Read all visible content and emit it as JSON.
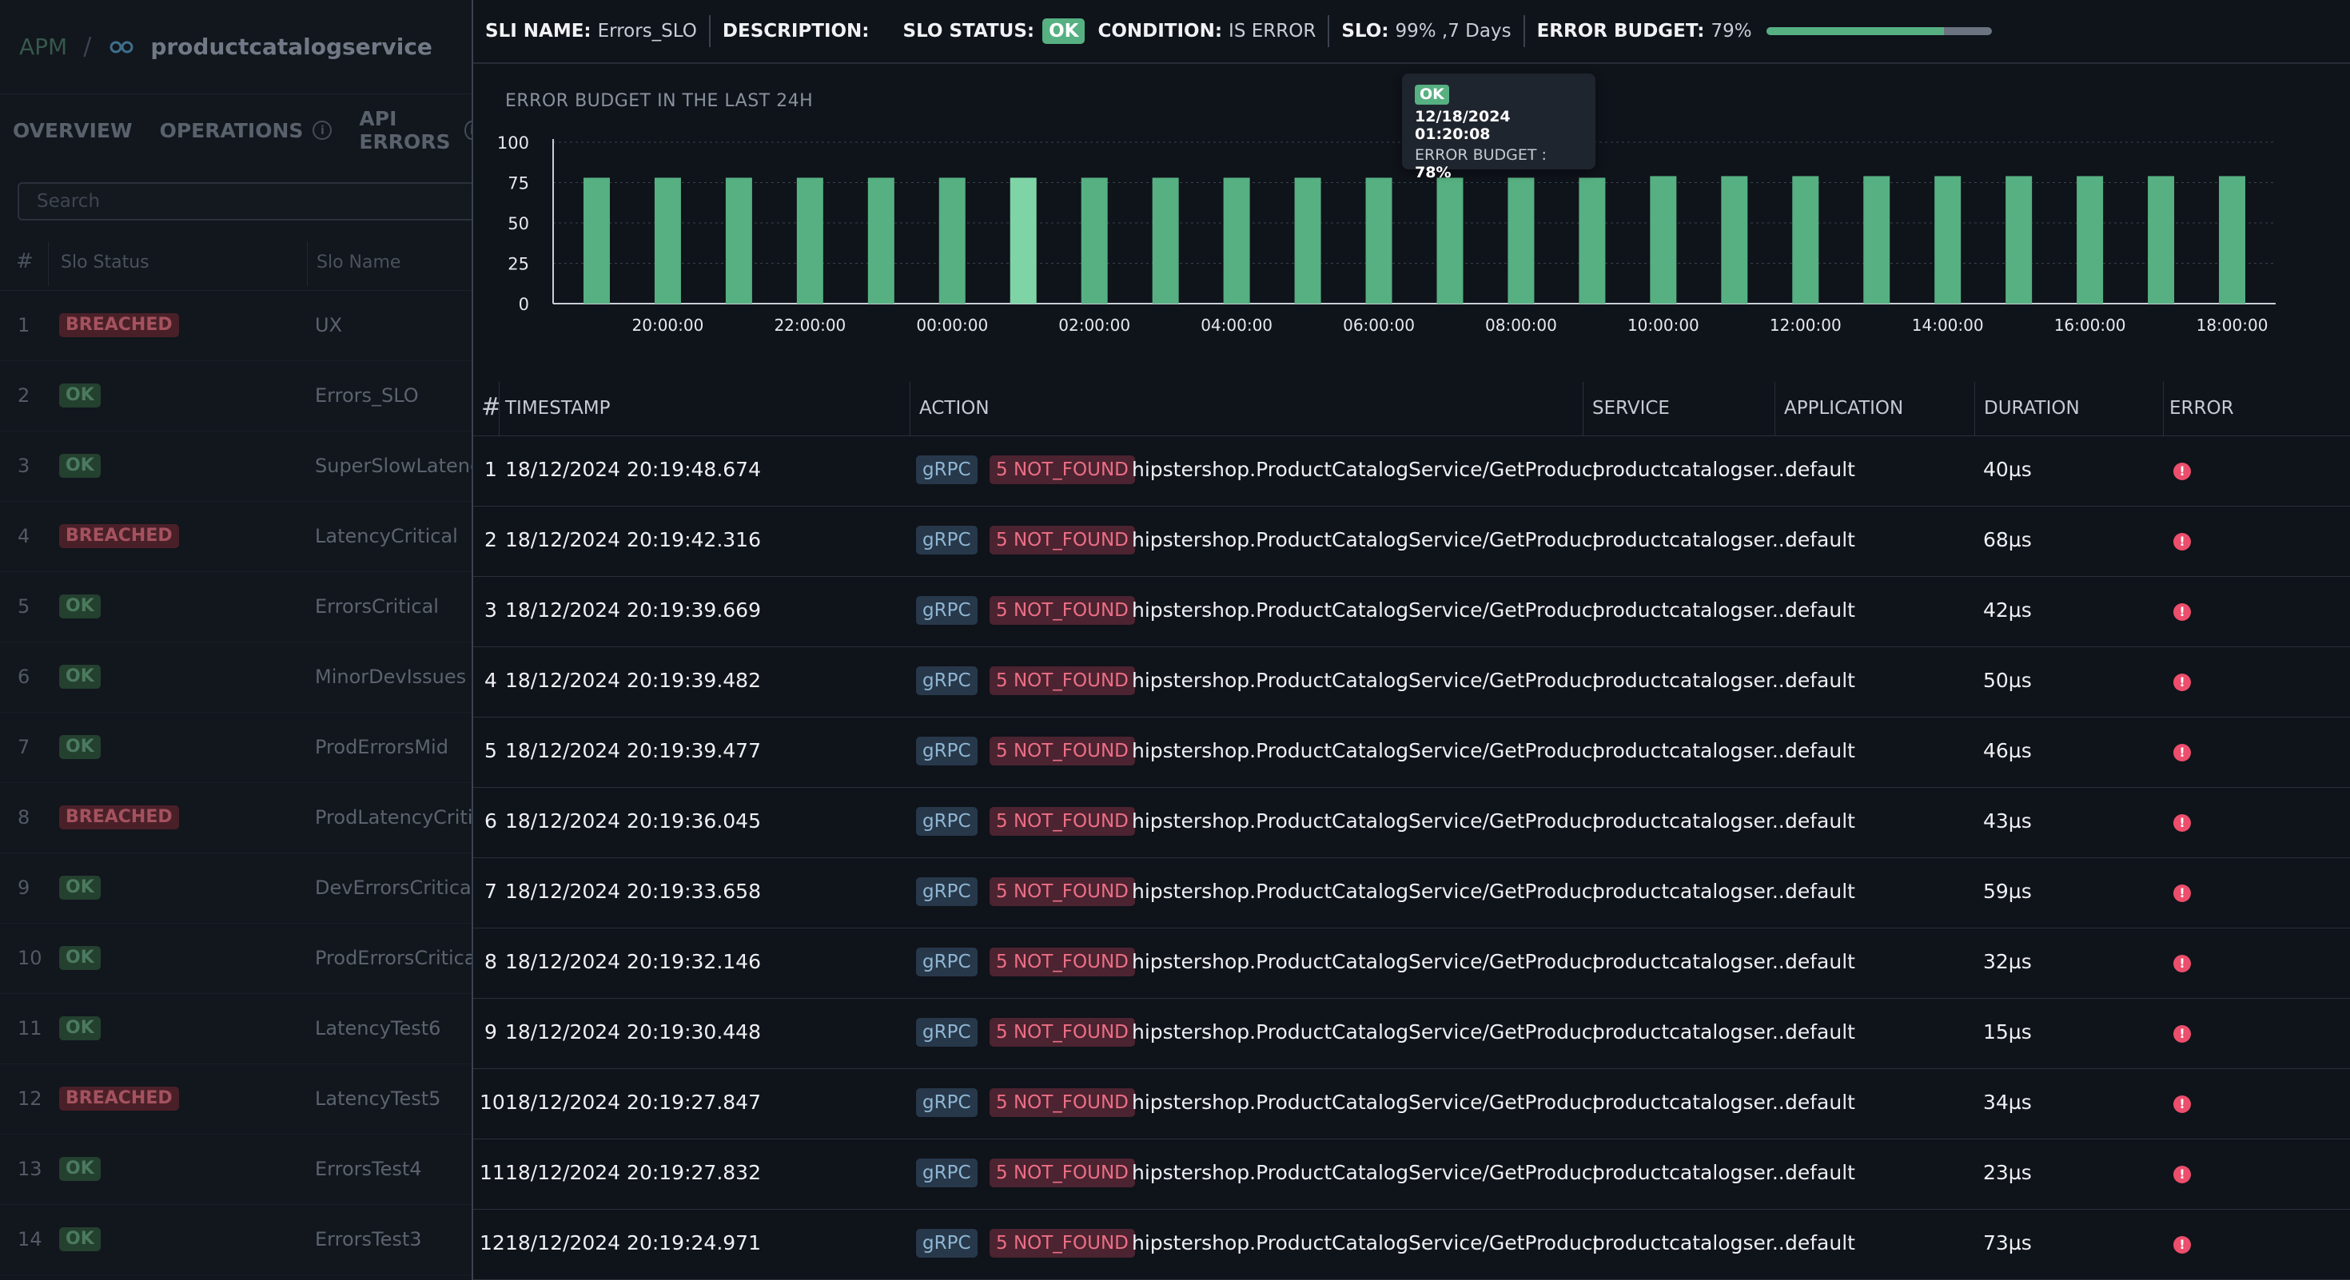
{
  "left_panel": {
    "breadcrumb": {
      "apm": "APM",
      "separator": "/",
      "service": "productcatalogservice"
    },
    "tabs": [
      {
        "label": "OVERVIEW"
      },
      {
        "label": "OPERATIONS"
      },
      {
        "label": "API ERRORS"
      }
    ],
    "search_placeholder": "Search",
    "columns": [
      "#",
      "Slo Status",
      "Slo Name"
    ],
    "rows": [
      {
        "num": "1",
        "status": "BREACHED",
        "name": "UX"
      },
      {
        "num": "2",
        "status": "OK",
        "name": "Errors_SLO"
      },
      {
        "num": "3",
        "status": "OK",
        "name": "SuperSlowLatency"
      },
      {
        "num": "4",
        "status": "BREACHED",
        "name": "LatencyCritical"
      },
      {
        "num": "5",
        "status": "OK",
        "name": "ErrorsCritical"
      },
      {
        "num": "6",
        "status": "OK",
        "name": "MinorDevIssues"
      },
      {
        "num": "7",
        "status": "OK",
        "name": "ProdErrorsMid"
      },
      {
        "num": "8",
        "status": "BREACHED",
        "name": "ProdLatencyCritical"
      },
      {
        "num": "9",
        "status": "OK",
        "name": "DevErrorsCritical"
      },
      {
        "num": "10",
        "status": "OK",
        "name": "ProdErrorsCritical"
      },
      {
        "num": "11",
        "status": "OK",
        "name": "LatencyTest6"
      },
      {
        "num": "12",
        "status": "BREACHED",
        "name": "LatencyTest5"
      },
      {
        "num": "13",
        "status": "OK",
        "name": "ErrorsTest4"
      },
      {
        "num": "14",
        "status": "OK",
        "name": "ErrorsTest3"
      }
    ]
  },
  "sli_bar": {
    "sli_name_label": "SLI NAME:",
    "sli_name": "Errors_SLO",
    "description_label": "DESCRIPTION:",
    "slo_status_label": "SLO STATUS:",
    "slo_status": "OK",
    "condition_label": "CONDITION:",
    "condition": "IS ERROR",
    "slo_label": "SLO:",
    "slo": "99% ,7 Days",
    "error_budget_label": "ERROR BUDGET:",
    "error_budget": "79%",
    "error_budget_fraction": 0.79
  },
  "chart_data": {
    "type": "bar",
    "title": "ERROR BUDGET IN THE LAST 24H",
    "xlabel": "",
    "ylabel": "",
    "ylim": [
      0,
      100
    ],
    "yticks": [
      "0",
      "25",
      "50",
      "75",
      "100"
    ],
    "xticks": [
      "20:00:00",
      "22:00:00",
      "00:00:00",
      "02:00:00",
      "04:00:00",
      "06:00:00",
      "08:00:00",
      "10:00:00",
      "12:00:00",
      "14:00:00",
      "16:00:00",
      "18:00:00"
    ],
    "grid": true,
    "values": [
      78,
      78,
      78,
      78,
      78,
      78,
      78,
      78,
      78,
      78,
      78,
      78,
      78,
      78,
      78,
      79,
      79,
      79,
      79,
      79,
      79,
      79,
      79,
      79
    ],
    "highlight_index": 6,
    "bar_color": "#56b082",
    "highlight_color": "#7fd4a6"
  },
  "tooltip": {
    "status": "OK",
    "timestamp": "12/18/2024 01:20:08",
    "label": "ERROR BUDGET :",
    "value": "78%"
  },
  "table": {
    "columns": [
      "#",
      "TIMESTAMP",
      "ACTION",
      "SERVICE",
      "APPLICATION",
      "DURATION",
      "ERROR"
    ],
    "rows": [
      {
        "num": "1",
        "timestamp": "18/12/2024 20:19:48.674",
        "protocol": "gRPC",
        "status": "5 NOT_FOUND",
        "action": "hipstershop.ProductCatalogService/GetProduct",
        "service": "productcatalogser...",
        "application": "default",
        "duration": "40µs"
      },
      {
        "num": "2",
        "timestamp": "18/12/2024 20:19:42.316",
        "protocol": "gRPC",
        "status": "5 NOT_FOUND",
        "action": "hipstershop.ProductCatalogService/GetProduct",
        "service": "productcatalogser...",
        "application": "default",
        "duration": "68µs"
      },
      {
        "num": "3",
        "timestamp": "18/12/2024 20:19:39.669",
        "protocol": "gRPC",
        "status": "5 NOT_FOUND",
        "action": "hipstershop.ProductCatalogService/GetProduct",
        "service": "productcatalogser...",
        "application": "default",
        "duration": "42µs"
      },
      {
        "num": "4",
        "timestamp": "18/12/2024 20:19:39.482",
        "protocol": "gRPC",
        "status": "5 NOT_FOUND",
        "action": "hipstershop.ProductCatalogService/GetProduct",
        "service": "productcatalogser...",
        "application": "default",
        "duration": "50µs"
      },
      {
        "num": "5",
        "timestamp": "18/12/2024 20:19:39.477",
        "protocol": "gRPC",
        "status": "5 NOT_FOUND",
        "action": "hipstershop.ProductCatalogService/GetProduct",
        "service": "productcatalogser...",
        "application": "default",
        "duration": "46µs"
      },
      {
        "num": "6",
        "timestamp": "18/12/2024 20:19:36.045",
        "protocol": "gRPC",
        "status": "5 NOT_FOUND",
        "action": "hipstershop.ProductCatalogService/GetProduct",
        "service": "productcatalogser...",
        "application": "default",
        "duration": "43µs"
      },
      {
        "num": "7",
        "timestamp": "18/12/2024 20:19:33.658",
        "protocol": "gRPC",
        "status": "5 NOT_FOUND",
        "action": "hipstershop.ProductCatalogService/GetProduct",
        "service": "productcatalogser...",
        "application": "default",
        "duration": "59µs"
      },
      {
        "num": "8",
        "timestamp": "18/12/2024 20:19:32.146",
        "protocol": "gRPC",
        "status": "5 NOT_FOUND",
        "action": "hipstershop.ProductCatalogService/GetProduct",
        "service": "productcatalogser...",
        "application": "default",
        "duration": "32µs"
      },
      {
        "num": "9",
        "timestamp": "18/12/2024 20:19:30.448",
        "protocol": "gRPC",
        "status": "5 NOT_FOUND",
        "action": "hipstershop.ProductCatalogService/GetProduct",
        "service": "productcatalogser...",
        "application": "default",
        "duration": "15µs"
      },
      {
        "num": "10",
        "timestamp": "18/12/2024 20:19:27.847",
        "protocol": "gRPC",
        "status": "5 NOT_FOUND",
        "action": "hipstershop.ProductCatalogService/GetProduct",
        "service": "productcatalogser...",
        "application": "default",
        "duration": "34µs"
      },
      {
        "num": "11",
        "timestamp": "18/12/2024 20:19:27.832",
        "protocol": "gRPC",
        "status": "5 NOT_FOUND",
        "action": "hipstershop.ProductCatalogService/GetProduct",
        "service": "productcatalogser...",
        "application": "default",
        "duration": "23µs"
      },
      {
        "num": "12",
        "timestamp": "18/12/2024 20:19:24.971",
        "protocol": "gRPC",
        "status": "5 NOT_FOUND",
        "action": "hipstershop.ProductCatalogService/GetProduct",
        "service": "productcatalogser...",
        "application": "default",
        "duration": "73µs"
      }
    ],
    "error_icon": "error-circle-icon"
  },
  "colors": {
    "ok": "#56b082",
    "breached": "#a4525f",
    "error": "#ec4e6c",
    "grpc_bg": "#27384a",
    "not_found_bg": "#4c2330"
  }
}
